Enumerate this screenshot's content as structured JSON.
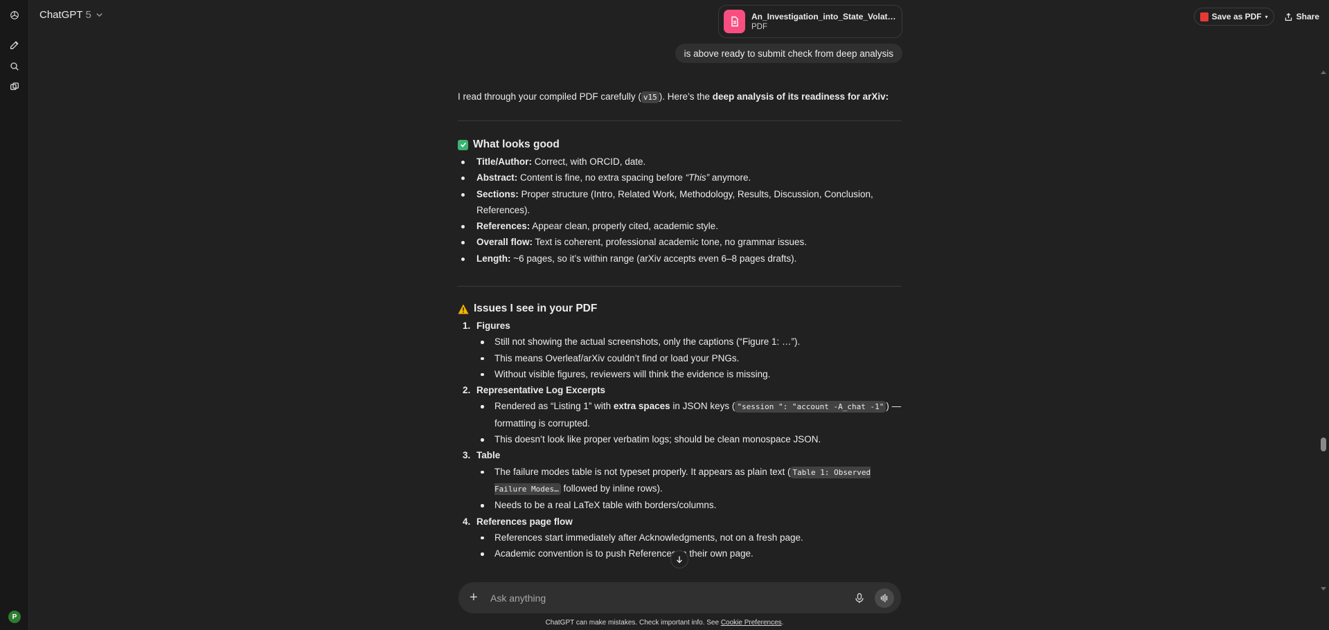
{
  "header": {
    "model_name": "ChatGPT",
    "model_version": "5",
    "save_pdf_label": "Save as PDF",
    "share_label": "Share"
  },
  "attachment": {
    "name": "An_Investigation_into_State_Volatility_...",
    "type": "PDF"
  },
  "user_message": "is above ready to submit check from deep analysis",
  "reply": {
    "intro_prefix": "I read through your compiled PDF carefully (",
    "intro_code": "v15",
    "intro_middle": "). Here’s the ",
    "intro_bold": "deep analysis of its readiness for arXiv:",
    "good_heading": "What looks good",
    "good_items": [
      {
        "label": "Title/Author:",
        "text": " Correct, with ORCID, date."
      },
      {
        "label": "Abstract:",
        "text": " Content is fine, no extra spacing before ",
        "italic": "“This”",
        "tail": " anymore."
      },
      {
        "label": "Sections:",
        "text": " Proper structure (Intro, Related Work, Methodology, Results, Discussion, Conclusion, References)."
      },
      {
        "label": "References:",
        "text": " Appear clean, properly cited, academic style."
      },
      {
        "label": "Overall flow:",
        "text": " Text is coherent, professional academic tone, no grammar issues."
      },
      {
        "label": "Length:",
        "text": " ~6 pages, so it’s within range (arXiv accepts even 6–8 pages drafts)."
      }
    ],
    "issues_heading": "Issues I see in your PDF",
    "issues": [
      {
        "n": "1.",
        "title": "Figures"
      },
      {
        "n": "2.",
        "title": "Representative Log Excerpts"
      },
      {
        "n": "3.",
        "title": "Table"
      },
      {
        "n": "4.",
        "title": "References page flow"
      }
    ],
    "fig_items": [
      "Still not showing the actual screenshots, only the captions (“Figure 1: …”).",
      "This means Overleaf/arXiv couldn’t find or load your PNGs.",
      "Without visible figures, reviewers will think the evidence is missing."
    ],
    "log_1_a": "Rendered as “Listing 1” with ",
    "log_1_b": "extra spaces",
    "log_1_c": " in JSON keys (",
    "log_1_code": "\"session \": \"account -A_chat -1\"",
    "log_1_d": ") — formatting is corrupted.",
    "log_2": "This doesn’t look like proper verbatim logs; should be clean monospace JSON.",
    "table_1_a": "The failure modes table is not typeset properly. It appears as plain text (",
    "table_1_code": "Table 1: Observed Failure Modes…",
    "table_1_b": " followed by inline rows).",
    "table_2": "Needs to be a real LaTeX table with borders/columns.",
    "ref_1": "References start immediately after Acknowledgments, not on a fresh page.",
    "ref_2": "Academic convention is to push References to their own page."
  },
  "composer": {
    "placeholder": "Ask anything"
  },
  "footer": {
    "text": "ChatGPT can make mistakes. Check important info. See ",
    "link": "Cookie Preferences",
    "end": "."
  },
  "user": {
    "avatar_initial": "P"
  }
}
